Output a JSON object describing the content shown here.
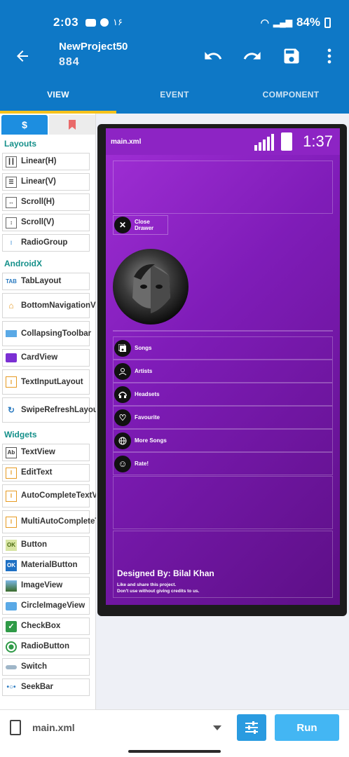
{
  "status_bar": {
    "time": "2:03",
    "extra": "۱۶",
    "battery": "84%"
  },
  "toolbar": {
    "title": "NewProject50",
    "subtitle": "884"
  },
  "tabs": [
    "VIEW",
    "EVENT",
    "COMPONENT"
  ],
  "palette": {
    "sections": {
      "layouts": "Layouts",
      "androidx": "AndroidX",
      "widgets": "Widgets"
    },
    "layouts": [
      "Linear(H)",
      "Linear(V)",
      "Scroll(H)",
      "Scroll(V)",
      "RadioGroup"
    ],
    "androidx": [
      "TabLayout",
      "BottomNavigationView",
      "CollapsingToolbar",
      "CardView",
      "TextInputLayout",
      "SwipeRefreshLayout"
    ],
    "widgets": [
      "TextView",
      "EditText",
      "AutoCompleteTextView",
      "MultiAutoCompleteTextView",
      "Button",
      "MaterialButton",
      "ImageView",
      "CircleImageView",
      "CheckBox",
      "RadioButton",
      "Switch",
      "SeekBar"
    ]
  },
  "preview": {
    "file": "main.xml",
    "clock": "1:37",
    "close_drawer": "Close Drawer",
    "menu": [
      "Songs",
      "Artists",
      "Headsets",
      "Favourite",
      "More Songs",
      "Rate!"
    ],
    "footer_title": "Designed By: Bilal Khan",
    "footer_line1": "Like and share this project.",
    "footer_line2": "Don't use without giving credits to us."
  },
  "bottom": {
    "file": "main.xml",
    "run": "Run"
  },
  "colors": {
    "primary": "#0e78c6",
    "accent": "#f6c21c",
    "purple": "#8d24c4"
  }
}
